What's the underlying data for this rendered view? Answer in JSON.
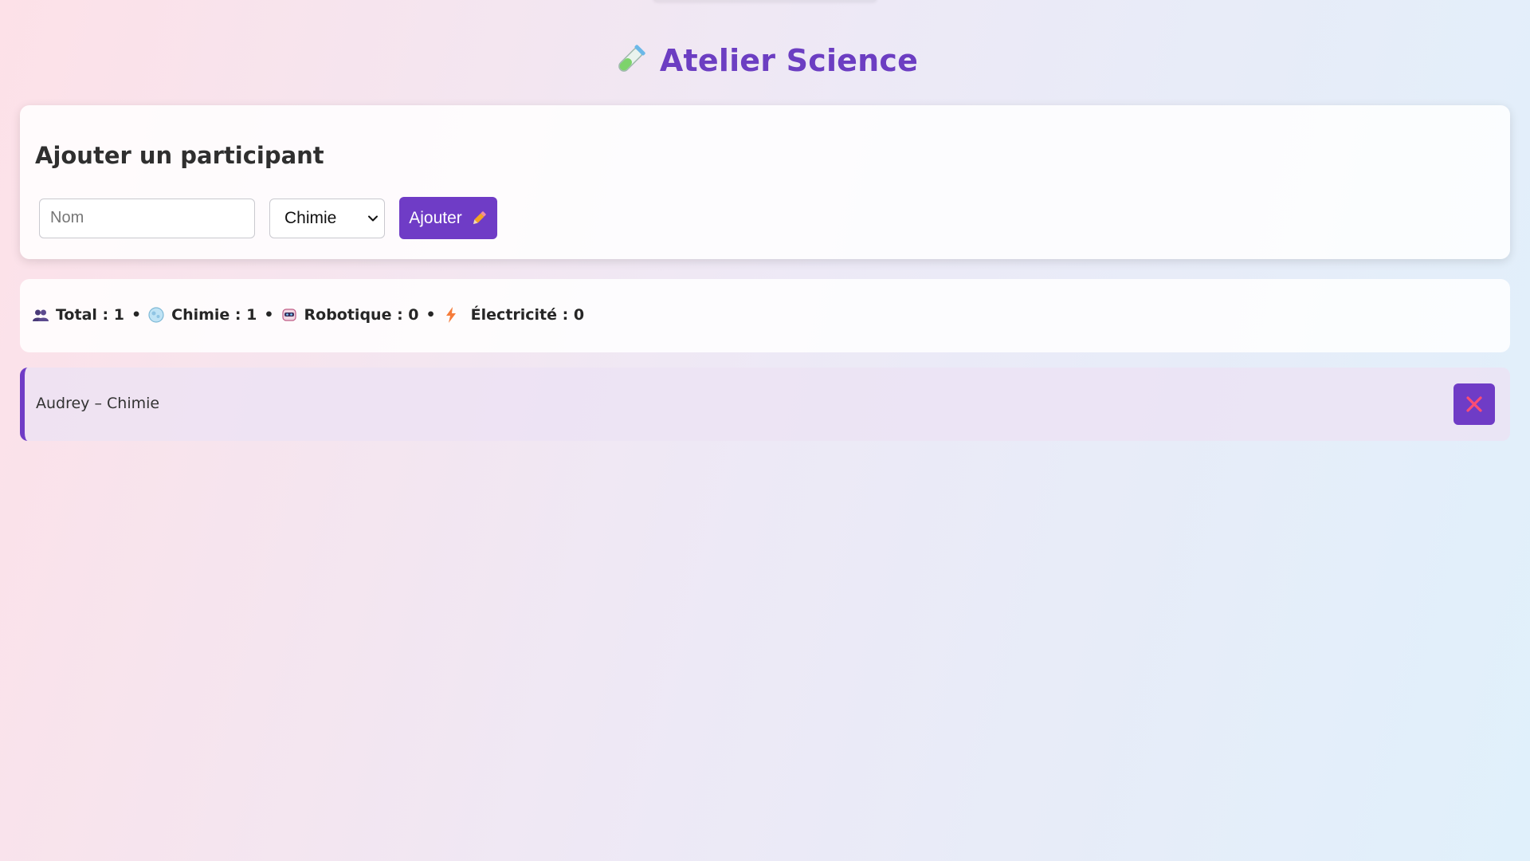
{
  "app": {
    "title": "Atelier Science",
    "title_icon": "test-tube-icon",
    "accent_color": "#6f3cc6"
  },
  "form": {
    "heading": "Ajouter un participant",
    "name_input": {
      "placeholder": "Nom",
      "value": ""
    },
    "workshop_select": {
      "selected": "Chimie"
    },
    "add_button": {
      "label": "Ajouter",
      "icon": "pencil-icon"
    }
  },
  "stats": {
    "total": {
      "icon": "people-icon",
      "label": "Total : 1"
    },
    "chimie": {
      "icon": "flask-bubble-icon",
      "label": "Chimie : 1"
    },
    "robotique": {
      "icon": "robot-icon",
      "label": "Robotique : 0"
    },
    "electricite": {
      "icon": "lightning-icon",
      "label": "Électricité : 0"
    },
    "separator": "•"
  },
  "participants": [
    {
      "label": "Audrey – Chimie",
      "delete_icon": "close-icon"
    }
  ]
}
